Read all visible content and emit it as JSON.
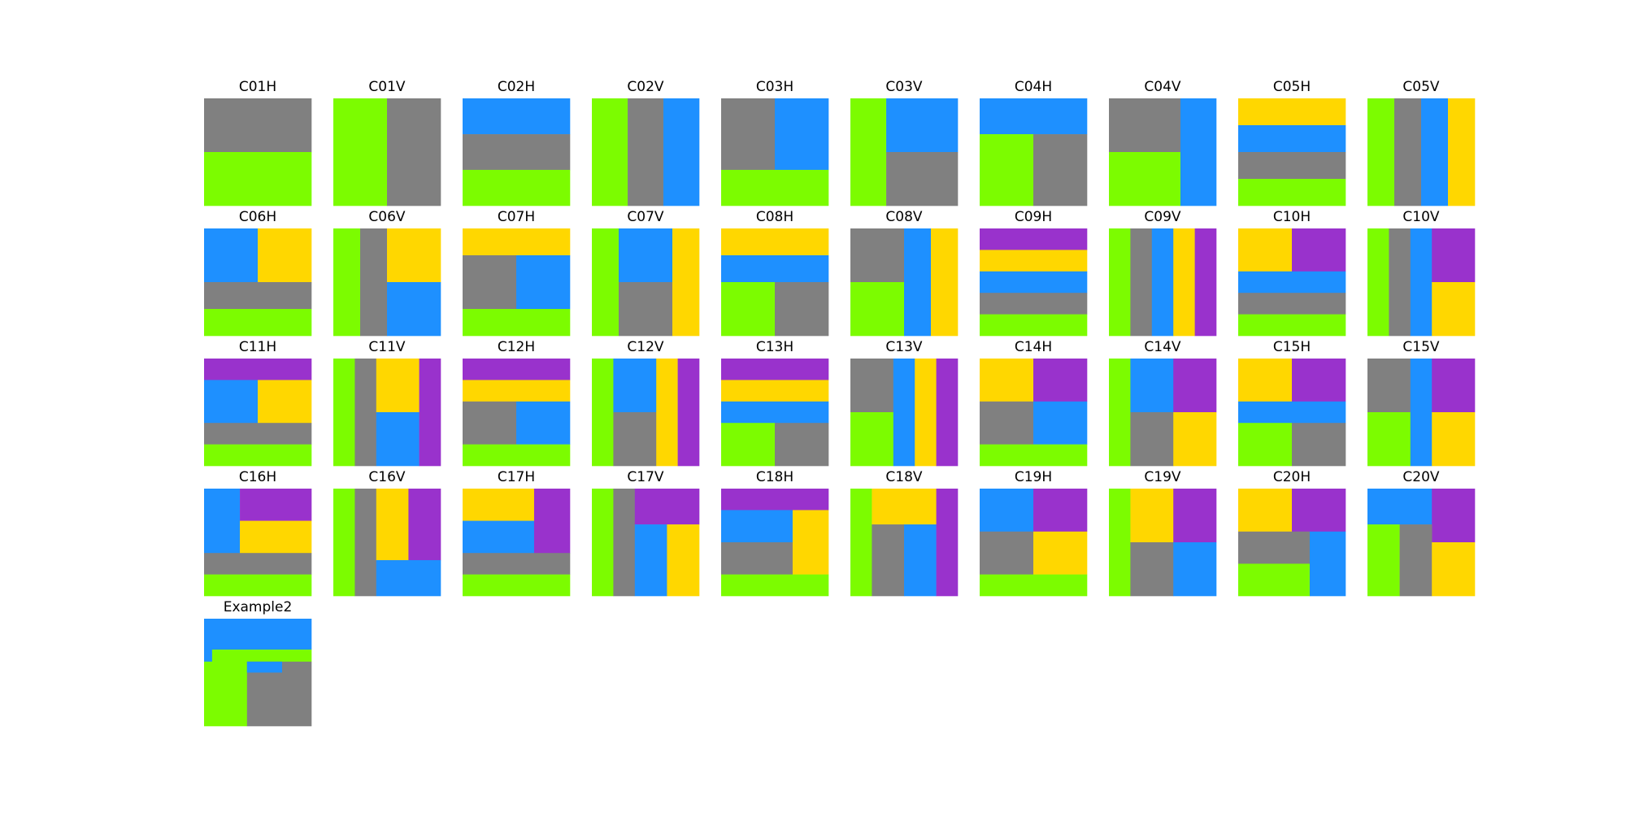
{
  "colors": {
    "G": "#808080",
    "L": "#7cfc00",
    "B": "#1e90ff",
    "Y": "#ffd700",
    "P": "#9932cc"
  },
  "tiles": [
    {
      "title": "C01H",
      "rects": [
        [
          0,
          0,
          8,
          4,
          "G"
        ],
        [
          0,
          4,
          8,
          4,
          "L"
        ]
      ]
    },
    {
      "title": "C01V",
      "rects": [
        [
          0,
          0,
          4,
          8,
          "L"
        ],
        [
          4,
          0,
          4,
          8,
          "G"
        ]
      ]
    },
    {
      "title": "C02H",
      "rects": [
        [
          0,
          0,
          8,
          2.67,
          "B"
        ],
        [
          0,
          2.67,
          8,
          2.67,
          "G"
        ],
        [
          0,
          5.33,
          8,
          2.67,
          "L"
        ]
      ]
    },
    {
      "title": "C02V",
      "rects": [
        [
          0,
          0,
          2.67,
          8,
          "L"
        ],
        [
          2.67,
          0,
          2.67,
          8,
          "G"
        ],
        [
          5.33,
          0,
          2.67,
          8,
          "B"
        ]
      ]
    },
    {
      "title": "C03H",
      "rects": [
        [
          0,
          0,
          4,
          5.33,
          "G"
        ],
        [
          4,
          0,
          4,
          5.33,
          "B"
        ],
        [
          0,
          5.33,
          8,
          2.67,
          "L"
        ]
      ]
    },
    {
      "title": "C03V",
      "rects": [
        [
          0,
          0,
          2.67,
          8,
          "L"
        ],
        [
          2.67,
          0,
          5.33,
          4,
          "B"
        ],
        [
          2.67,
          4,
          5.33,
          4,
          "G"
        ]
      ]
    },
    {
      "title": "C04H",
      "rects": [
        [
          0,
          0,
          8,
          2.67,
          "B"
        ],
        [
          0,
          2.67,
          4,
          5.33,
          "L"
        ],
        [
          4,
          2.67,
          4,
          5.33,
          "G"
        ]
      ]
    },
    {
      "title": "C04V",
      "rects": [
        [
          0,
          0,
          5.33,
          4,
          "G"
        ],
        [
          0,
          4,
          5.33,
          4,
          "L"
        ],
        [
          5.33,
          0,
          2.67,
          8,
          "B"
        ]
      ]
    },
    {
      "title": "C05H",
      "rects": [
        [
          0,
          0,
          8,
          2,
          "Y"
        ],
        [
          0,
          2,
          8,
          2,
          "B"
        ],
        [
          0,
          4,
          8,
          2,
          "G"
        ],
        [
          0,
          6,
          8,
          2,
          "L"
        ]
      ]
    },
    {
      "title": "C05V",
      "rects": [
        [
          0,
          0,
          2,
          8,
          "L"
        ],
        [
          2,
          0,
          2,
          8,
          "G"
        ],
        [
          4,
          0,
          2,
          8,
          "B"
        ],
        [
          6,
          0,
          2,
          8,
          "Y"
        ]
      ]
    },
    {
      "title": "C06H",
      "rects": [
        [
          0,
          0,
          4,
          4,
          "B"
        ],
        [
          4,
          0,
          4,
          4,
          "Y"
        ],
        [
          0,
          4,
          8,
          2,
          "G"
        ],
        [
          0,
          6,
          8,
          2,
          "L"
        ]
      ]
    },
    {
      "title": "C06V",
      "rects": [
        [
          0,
          0,
          2,
          8,
          "L"
        ],
        [
          2,
          0,
          2,
          8,
          "G"
        ],
        [
          4,
          0,
          4,
          4,
          "Y"
        ],
        [
          4,
          4,
          4,
          4,
          "B"
        ]
      ]
    },
    {
      "title": "C07H",
      "rects": [
        [
          0,
          0,
          8,
          2,
          "Y"
        ],
        [
          0,
          2,
          4,
          4,
          "G"
        ],
        [
          4,
          2,
          4,
          4,
          "B"
        ],
        [
          0,
          6,
          8,
          2,
          "L"
        ]
      ]
    },
    {
      "title": "C07V",
      "rects": [
        [
          0,
          0,
          2,
          8,
          "L"
        ],
        [
          2,
          0,
          4,
          4,
          "B"
        ],
        [
          2,
          4,
          4,
          4,
          "G"
        ],
        [
          6,
          0,
          2,
          8,
          "Y"
        ]
      ]
    },
    {
      "title": "C08H",
      "rects": [
        [
          0,
          0,
          8,
          2,
          "Y"
        ],
        [
          0,
          2,
          8,
          2,
          "B"
        ],
        [
          0,
          4,
          4,
          4,
          "L"
        ],
        [
          4,
          4,
          4,
          4,
          "G"
        ]
      ]
    },
    {
      "title": "C08V",
      "rects": [
        [
          0,
          0,
          4,
          4,
          "G"
        ],
        [
          0,
          4,
          4,
          4,
          "L"
        ],
        [
          4,
          0,
          2,
          8,
          "B"
        ],
        [
          6,
          0,
          2,
          8,
          "Y"
        ]
      ]
    },
    {
      "title": "C09H",
      "rects": [
        [
          0,
          0,
          8,
          1.6,
          "P"
        ],
        [
          0,
          1.6,
          8,
          1.6,
          "Y"
        ],
        [
          0,
          3.2,
          8,
          1.6,
          "B"
        ],
        [
          0,
          4.8,
          8,
          1.6,
          "G"
        ],
        [
          0,
          6.4,
          8,
          1.6,
          "L"
        ]
      ]
    },
    {
      "title": "C09V",
      "rects": [
        [
          0,
          0,
          1.6,
          8,
          "L"
        ],
        [
          1.6,
          0,
          1.6,
          8,
          "G"
        ],
        [
          3.2,
          0,
          1.6,
          8,
          "B"
        ],
        [
          4.8,
          0,
          1.6,
          8,
          "Y"
        ],
        [
          6.4,
          0,
          1.6,
          8,
          "P"
        ]
      ]
    },
    {
      "title": "C10H",
      "rects": [
        [
          0,
          0,
          4,
          3.2,
          "Y"
        ],
        [
          4,
          0,
          4,
          3.2,
          "P"
        ],
        [
          0,
          3.2,
          8,
          1.6,
          "B"
        ],
        [
          0,
          4.8,
          8,
          1.6,
          "G"
        ],
        [
          0,
          6.4,
          8,
          1.6,
          "L"
        ]
      ]
    },
    {
      "title": "C10V",
      "rects": [
        [
          0,
          0,
          1.6,
          8,
          "L"
        ],
        [
          1.6,
          0,
          1.6,
          8,
          "G"
        ],
        [
          3.2,
          0,
          1.6,
          8,
          "B"
        ],
        [
          4.8,
          0,
          3.2,
          4,
          "P"
        ],
        [
          4.8,
          4,
          3.2,
          4,
          "Y"
        ]
      ]
    },
    {
      "title": "C11H",
      "rects": [
        [
          0,
          0,
          8,
          1.6,
          "P"
        ],
        [
          0,
          1.6,
          4,
          3.2,
          "B"
        ],
        [
          4,
          1.6,
          4,
          3.2,
          "Y"
        ],
        [
          0,
          4.8,
          8,
          1.6,
          "G"
        ],
        [
          0,
          6.4,
          8,
          1.6,
          "L"
        ]
      ]
    },
    {
      "title": "C11V",
      "rects": [
        [
          0,
          0,
          1.6,
          8,
          "L"
        ],
        [
          1.6,
          0,
          1.6,
          8,
          "G"
        ],
        [
          3.2,
          0,
          3.2,
          4,
          "Y"
        ],
        [
          3.2,
          4,
          3.2,
          4,
          "B"
        ],
        [
          6.4,
          0,
          1.6,
          8,
          "P"
        ]
      ]
    },
    {
      "title": "C12H",
      "rects": [
        [
          0,
          0,
          8,
          1.6,
          "P"
        ],
        [
          0,
          1.6,
          8,
          1.6,
          "Y"
        ],
        [
          0,
          3.2,
          4,
          3.2,
          "G"
        ],
        [
          4,
          3.2,
          4,
          3.2,
          "B"
        ],
        [
          0,
          6.4,
          8,
          1.6,
          "L"
        ]
      ]
    },
    {
      "title": "C12V",
      "rects": [
        [
          0,
          0,
          1.6,
          8,
          "L"
        ],
        [
          1.6,
          0,
          3.2,
          4,
          "B"
        ],
        [
          1.6,
          4,
          3.2,
          4,
          "G"
        ],
        [
          4.8,
          0,
          1.6,
          8,
          "Y"
        ],
        [
          6.4,
          0,
          1.6,
          8,
          "P"
        ]
      ]
    },
    {
      "title": "C13H",
      "rects": [
        [
          0,
          0,
          8,
          1.6,
          "P"
        ],
        [
          0,
          1.6,
          8,
          1.6,
          "Y"
        ],
        [
          0,
          3.2,
          8,
          1.6,
          "B"
        ],
        [
          0,
          4.8,
          4,
          3.2,
          "L"
        ],
        [
          4,
          4.8,
          4,
          3.2,
          "G"
        ]
      ]
    },
    {
      "title": "C13V",
      "rects": [
        [
          0,
          0,
          3.2,
          4,
          "G"
        ],
        [
          0,
          4,
          3.2,
          4,
          "L"
        ],
        [
          3.2,
          0,
          1.6,
          8,
          "B"
        ],
        [
          4.8,
          0,
          1.6,
          8,
          "Y"
        ],
        [
          6.4,
          0,
          1.6,
          8,
          "P"
        ]
      ]
    },
    {
      "title": "C14H",
      "rects": [
        [
          0,
          0,
          4,
          3.2,
          "Y"
        ],
        [
          4,
          0,
          4,
          3.2,
          "P"
        ],
        [
          0,
          3.2,
          4,
          3.2,
          "G"
        ],
        [
          4,
          3.2,
          4,
          3.2,
          "B"
        ],
        [
          0,
          6.4,
          8,
          1.6,
          "L"
        ]
      ]
    },
    {
      "title": "C14V",
      "rects": [
        [
          0,
          0,
          1.6,
          8,
          "L"
        ],
        [
          1.6,
          0,
          3.2,
          4,
          "B"
        ],
        [
          4.8,
          0,
          3.2,
          4,
          "P"
        ],
        [
          1.6,
          4,
          3.2,
          4,
          "G"
        ],
        [
          4.8,
          4,
          3.2,
          4,
          "Y"
        ]
      ]
    },
    {
      "title": "C15H",
      "rects": [
        [
          0,
          0,
          4,
          3.2,
          "Y"
        ],
        [
          4,
          0,
          4,
          3.2,
          "P"
        ],
        [
          0,
          3.2,
          8,
          1.6,
          "B"
        ],
        [
          0,
          4.8,
          4,
          3.2,
          "L"
        ],
        [
          4,
          4.8,
          4,
          3.2,
          "G"
        ]
      ]
    },
    {
      "title": "C15V",
      "rects": [
        [
          0,
          0,
          3.2,
          4,
          "G"
        ],
        [
          0,
          4,
          3.2,
          4,
          "L"
        ],
        [
          3.2,
          0,
          1.6,
          8,
          "B"
        ],
        [
          4.8,
          0,
          3.2,
          4,
          "P"
        ],
        [
          4.8,
          4,
          3.2,
          4,
          "Y"
        ]
      ]
    },
    {
      "title": "C16H",
      "rects": [
        [
          0,
          0,
          2.67,
          4.8,
          "B"
        ],
        [
          2.67,
          0,
          5.33,
          2.4,
          "P"
        ],
        [
          2.67,
          2.4,
          5.33,
          2.4,
          "Y"
        ],
        [
          0,
          4.8,
          8,
          1.6,
          "G"
        ],
        [
          0,
          6.4,
          8,
          1.6,
          "L"
        ]
      ]
    },
    {
      "title": "C16V",
      "rects": [
        [
          0,
          0,
          1.6,
          8,
          "L"
        ],
        [
          1.6,
          0,
          1.6,
          8,
          "G"
        ],
        [
          3.2,
          0,
          2.4,
          5.33,
          "Y"
        ],
        [
          5.6,
          0,
          2.4,
          5.33,
          "P"
        ],
        [
          3.2,
          5.33,
          4.8,
          2.67,
          "B"
        ]
      ]
    },
    {
      "title": "C17H",
      "rects": [
        [
          0,
          0,
          5.33,
          2.4,
          "Y"
        ],
        [
          0,
          2.4,
          5.33,
          2.4,
          "B"
        ],
        [
          5.33,
          0,
          2.67,
          4.8,
          "P"
        ],
        [
          0,
          4.8,
          8,
          1.6,
          "G"
        ],
        [
          0,
          6.4,
          8,
          1.6,
          "L"
        ]
      ]
    },
    {
      "title": "C17V",
      "rects": [
        [
          0,
          0,
          1.6,
          8,
          "L"
        ],
        [
          1.6,
          0,
          1.6,
          8,
          "G"
        ],
        [
          3.2,
          0,
          4.8,
          2.67,
          "P"
        ],
        [
          3.2,
          2.67,
          2.4,
          5.33,
          "B"
        ],
        [
          5.6,
          2.67,
          2.4,
          5.33,
          "Y"
        ]
      ]
    },
    {
      "title": "C18H",
      "rects": [
        [
          0,
          0,
          8,
          1.6,
          "P"
        ],
        [
          0,
          1.6,
          5.33,
          2.4,
          "B"
        ],
        [
          0,
          4,
          5.33,
          2.4,
          "G"
        ],
        [
          5.33,
          1.6,
          2.67,
          4.8,
          "Y"
        ],
        [
          0,
          6.4,
          8,
          1.6,
          "L"
        ]
      ]
    },
    {
      "title": "C18V",
      "rects": [
        [
          0,
          0,
          1.6,
          8,
          "L"
        ],
        [
          1.6,
          0,
          4.8,
          2.67,
          "Y"
        ],
        [
          1.6,
          2.67,
          2.4,
          5.33,
          "G"
        ],
        [
          4,
          2.67,
          2.4,
          5.33,
          "B"
        ],
        [
          6.4,
          0,
          1.6,
          8,
          "P"
        ]
      ]
    },
    {
      "title": "C19H",
      "rects": [
        [
          0,
          0,
          4,
          3.2,
          "B"
        ],
        [
          4,
          0,
          4,
          3.2,
          "P"
        ],
        [
          0,
          3.2,
          4,
          3.2,
          "G"
        ],
        [
          4,
          3.2,
          4,
          3.2,
          "Y"
        ],
        [
          0,
          6.4,
          8,
          1.6,
          "L"
        ]
      ]
    },
    {
      "title": "C19V",
      "rects": [
        [
          0,
          0,
          1.6,
          8,
          "L"
        ],
        [
          1.6,
          0,
          3.2,
          4,
          "Y"
        ],
        [
          4.8,
          0,
          3.2,
          4,
          "P"
        ],
        [
          1.6,
          4,
          3.2,
          4,
          "G"
        ],
        [
          4.8,
          4,
          3.2,
          4,
          "B"
        ]
      ]
    },
    {
      "title": "C20H",
      "rects": [
        [
          0,
          0,
          4,
          3.2,
          "Y"
        ],
        [
          4,
          0,
          4,
          3.2,
          "P"
        ],
        [
          0,
          3.2,
          5.33,
          2.4,
          "G"
        ],
        [
          0,
          5.6,
          5.33,
          2.4,
          "L"
        ],
        [
          5.33,
          3.2,
          2.67,
          4.8,
          "B"
        ]
      ]
    },
    {
      "title": "C20V",
      "rects": [
        [
          0,
          0,
          4.8,
          2.67,
          "B"
        ],
        [
          4.8,
          0,
          3.2,
          4,
          "P"
        ],
        [
          0,
          2.67,
          2.4,
          5.33,
          "L"
        ],
        [
          2.4,
          2.67,
          2.4,
          5.33,
          "G"
        ],
        [
          4.8,
          4,
          3.2,
          4,
          "Y"
        ]
      ]
    },
    {
      "title": "Example2",
      "rects": [
        [
          0,
          0,
          8,
          2.3,
          "B"
        ],
        [
          0,
          2.3,
          0.6,
          0.9,
          "B"
        ],
        [
          0.6,
          2.3,
          7.4,
          0.9,
          "L"
        ],
        [
          0,
          3.2,
          3.2,
          4.8,
          "L"
        ],
        [
          3.2,
          3.2,
          4.8,
          4.8,
          "G"
        ],
        [
          3.2,
          3.2,
          2.6,
          0.8,
          "B"
        ]
      ]
    }
  ]
}
